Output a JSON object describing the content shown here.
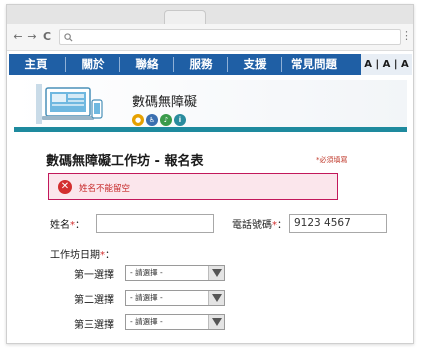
{
  "browser": {
    "back_icon": "←",
    "forward_icon": "→",
    "reload_icon": "C",
    "search_icon": "magnifier",
    "menu_icon": "⋮"
  },
  "nav": {
    "items": [
      "主頁",
      "關於",
      "聯絡",
      "服務",
      "支援",
      "常見問題"
    ],
    "font_size_control": "A | A | A"
  },
  "banner": {
    "title": "數碼無障礙",
    "icons": [
      "eye-icon",
      "accessibility-icon",
      "hearing-icon",
      "info-icon"
    ]
  },
  "form": {
    "title": "數碼無障礙工作坊 - 報名表",
    "required_note": "*必須填寫",
    "error_message": "姓名不能留空",
    "name_label": "姓名",
    "name_value": "",
    "phone_label": "電話號碼",
    "phone_value": "9123 4567",
    "date_label": "工作坊日期",
    "choices": [
      {
        "label": "第一選擇",
        "selected": "- 請選擇 -"
      },
      {
        "label": "第二選擇",
        "selected": "- 請選擇 -"
      },
      {
        "label": "第三選擇",
        "selected": "- 請選擇 -"
      }
    ]
  },
  "colors": {
    "nav_bg": "#1f5fa5",
    "accent_teal": "#1e8a9e",
    "error": "#d32f2f"
  }
}
